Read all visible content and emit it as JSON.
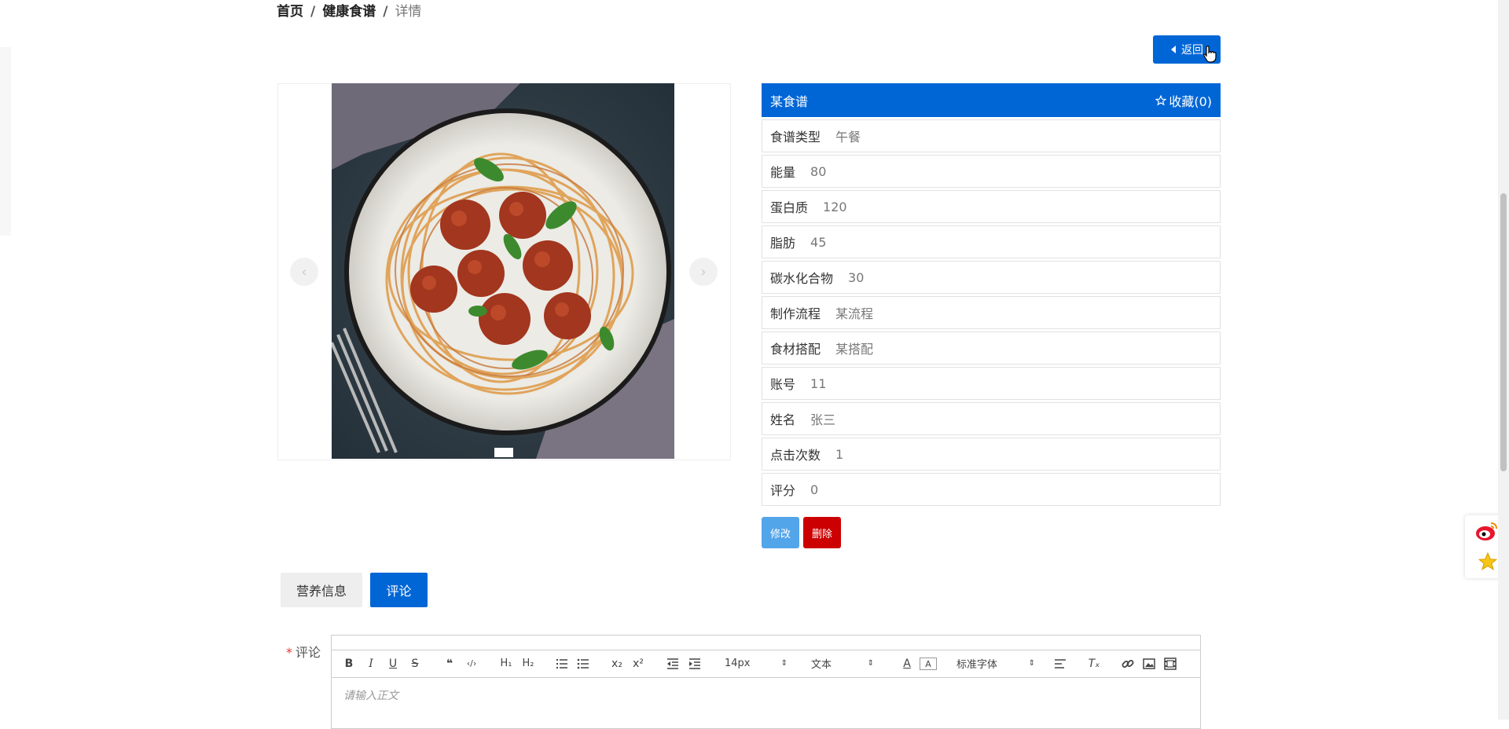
{
  "breadcrumb": {
    "home": "首页",
    "section": "健康食谱",
    "current": "详情",
    "separator": "/"
  },
  "back_button": {
    "label": "返回"
  },
  "recipe": {
    "title": "某食谱",
    "favorite_label": "收藏(0)",
    "fields": [
      {
        "label": "食谱类型",
        "value": "午餐"
      },
      {
        "label": "能量",
        "value": "80"
      },
      {
        "label": "蛋白质",
        "value": "120"
      },
      {
        "label": "脂肪",
        "value": "45"
      },
      {
        "label": "碳水化合物",
        "value": "30"
      },
      {
        "label": "制作流程",
        "value": "某流程"
      },
      {
        "label": "食材搭配",
        "value": "某搭配"
      },
      {
        "label": "账号",
        "value": "11"
      },
      {
        "label": "姓名",
        "value": "张三"
      },
      {
        "label": "点击次数",
        "value": "1"
      },
      {
        "label": "评分",
        "value": "0"
      }
    ]
  },
  "actions": {
    "edit": "修改",
    "delete": "删除"
  },
  "tabs": [
    {
      "label": "营养信息",
      "active": false
    },
    {
      "label": "评论",
      "active": true
    }
  ],
  "comment_form": {
    "label": "评论",
    "required_mark": "*",
    "placeholder": "请输入正文",
    "toolbar": {
      "font_size": "14px",
      "block_format": "文本",
      "font_family": "标准字体",
      "buttons": [
        "B",
        "I",
        "U",
        "S",
        "❝",
        "</>",
        "H1",
        "H2",
        "ordered-list",
        "bullet-list",
        "x₂",
        "x²",
        "outdent",
        "indent",
        "text-color",
        "background-color",
        "align",
        "clear-format",
        "link",
        "image",
        "video"
      ]
    }
  },
  "colors": {
    "primary": "#0066d6",
    "edit": "#53a5ea",
    "delete": "#cc0000"
  },
  "icons": [
    "caret-left-icon",
    "hand-cursor-icon",
    "star-outline-icon",
    "chevron-left-icon",
    "chevron-right-icon",
    "weibo-icon",
    "star-icon"
  ]
}
